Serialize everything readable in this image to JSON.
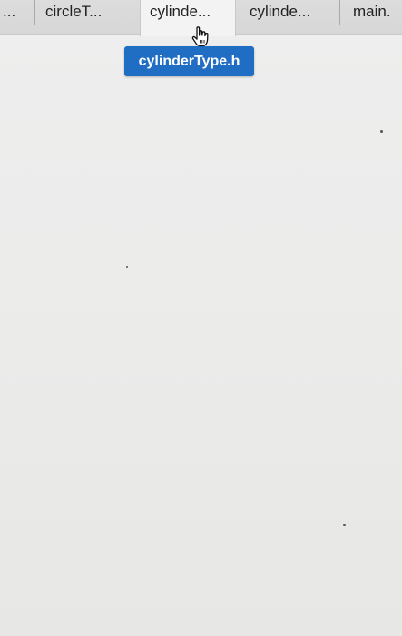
{
  "tabs": [
    {
      "label": "..."
    },
    {
      "label": "circleT..."
    },
    {
      "label": "cylinde..."
    },
    {
      "label": "cylinde..."
    },
    {
      "label": "main."
    }
  ],
  "active_tab_index": 2,
  "tooltip": {
    "text": "cylinderType.h"
  },
  "colors": {
    "tooltip_background": "#1f6ec4",
    "tooltip_text": "#ffffff",
    "tabbar_background": "#d9d9d9",
    "active_tab_background": "#f3f3f3",
    "content_background": "#ececec"
  },
  "icons": {
    "cursor": "hand-pointer-icon"
  }
}
